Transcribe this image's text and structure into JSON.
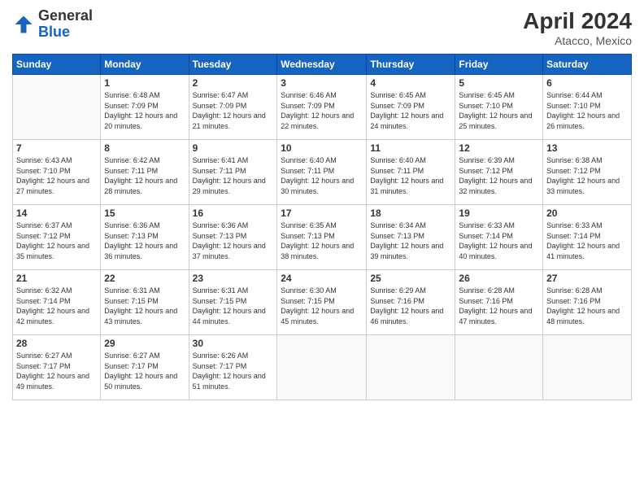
{
  "header": {
    "logo_general": "General",
    "logo_blue": "Blue",
    "month_title": "April 2024",
    "subtitle": "Atacco, Mexico"
  },
  "days_of_week": [
    "Sunday",
    "Monday",
    "Tuesday",
    "Wednesday",
    "Thursday",
    "Friday",
    "Saturday"
  ],
  "weeks": [
    [
      {
        "day": "",
        "sunrise": "",
        "sunset": "",
        "daylight": ""
      },
      {
        "day": "1",
        "sunrise": "Sunrise: 6:48 AM",
        "sunset": "Sunset: 7:09 PM",
        "daylight": "Daylight: 12 hours and 20 minutes."
      },
      {
        "day": "2",
        "sunrise": "Sunrise: 6:47 AM",
        "sunset": "Sunset: 7:09 PM",
        "daylight": "Daylight: 12 hours and 21 minutes."
      },
      {
        "day": "3",
        "sunrise": "Sunrise: 6:46 AM",
        "sunset": "Sunset: 7:09 PM",
        "daylight": "Daylight: 12 hours and 22 minutes."
      },
      {
        "day": "4",
        "sunrise": "Sunrise: 6:45 AM",
        "sunset": "Sunset: 7:09 PM",
        "daylight": "Daylight: 12 hours and 24 minutes."
      },
      {
        "day": "5",
        "sunrise": "Sunrise: 6:45 AM",
        "sunset": "Sunset: 7:10 PM",
        "daylight": "Daylight: 12 hours and 25 minutes."
      },
      {
        "day": "6",
        "sunrise": "Sunrise: 6:44 AM",
        "sunset": "Sunset: 7:10 PM",
        "daylight": "Daylight: 12 hours and 26 minutes."
      }
    ],
    [
      {
        "day": "7",
        "sunrise": "Sunrise: 6:43 AM",
        "sunset": "Sunset: 7:10 PM",
        "daylight": "Daylight: 12 hours and 27 minutes."
      },
      {
        "day": "8",
        "sunrise": "Sunrise: 6:42 AM",
        "sunset": "Sunset: 7:11 PM",
        "daylight": "Daylight: 12 hours and 28 minutes."
      },
      {
        "day": "9",
        "sunrise": "Sunrise: 6:41 AM",
        "sunset": "Sunset: 7:11 PM",
        "daylight": "Daylight: 12 hours and 29 minutes."
      },
      {
        "day": "10",
        "sunrise": "Sunrise: 6:40 AM",
        "sunset": "Sunset: 7:11 PM",
        "daylight": "Daylight: 12 hours and 30 minutes."
      },
      {
        "day": "11",
        "sunrise": "Sunrise: 6:40 AM",
        "sunset": "Sunset: 7:11 PM",
        "daylight": "Daylight: 12 hours and 31 minutes."
      },
      {
        "day": "12",
        "sunrise": "Sunrise: 6:39 AM",
        "sunset": "Sunset: 7:12 PM",
        "daylight": "Daylight: 12 hours and 32 minutes."
      },
      {
        "day": "13",
        "sunrise": "Sunrise: 6:38 AM",
        "sunset": "Sunset: 7:12 PM",
        "daylight": "Daylight: 12 hours and 33 minutes."
      }
    ],
    [
      {
        "day": "14",
        "sunrise": "Sunrise: 6:37 AM",
        "sunset": "Sunset: 7:12 PM",
        "daylight": "Daylight: 12 hours and 35 minutes."
      },
      {
        "day": "15",
        "sunrise": "Sunrise: 6:36 AM",
        "sunset": "Sunset: 7:13 PM",
        "daylight": "Daylight: 12 hours and 36 minutes."
      },
      {
        "day": "16",
        "sunrise": "Sunrise: 6:36 AM",
        "sunset": "Sunset: 7:13 PM",
        "daylight": "Daylight: 12 hours and 37 minutes."
      },
      {
        "day": "17",
        "sunrise": "Sunrise: 6:35 AM",
        "sunset": "Sunset: 7:13 PM",
        "daylight": "Daylight: 12 hours and 38 minutes."
      },
      {
        "day": "18",
        "sunrise": "Sunrise: 6:34 AM",
        "sunset": "Sunset: 7:13 PM",
        "daylight": "Daylight: 12 hours and 39 minutes."
      },
      {
        "day": "19",
        "sunrise": "Sunrise: 6:33 AM",
        "sunset": "Sunset: 7:14 PM",
        "daylight": "Daylight: 12 hours and 40 minutes."
      },
      {
        "day": "20",
        "sunrise": "Sunrise: 6:33 AM",
        "sunset": "Sunset: 7:14 PM",
        "daylight": "Daylight: 12 hours and 41 minutes."
      }
    ],
    [
      {
        "day": "21",
        "sunrise": "Sunrise: 6:32 AM",
        "sunset": "Sunset: 7:14 PM",
        "daylight": "Daylight: 12 hours and 42 minutes."
      },
      {
        "day": "22",
        "sunrise": "Sunrise: 6:31 AM",
        "sunset": "Sunset: 7:15 PM",
        "daylight": "Daylight: 12 hours and 43 minutes."
      },
      {
        "day": "23",
        "sunrise": "Sunrise: 6:31 AM",
        "sunset": "Sunset: 7:15 PM",
        "daylight": "Daylight: 12 hours and 44 minutes."
      },
      {
        "day": "24",
        "sunrise": "Sunrise: 6:30 AM",
        "sunset": "Sunset: 7:15 PM",
        "daylight": "Daylight: 12 hours and 45 minutes."
      },
      {
        "day": "25",
        "sunrise": "Sunrise: 6:29 AM",
        "sunset": "Sunset: 7:16 PM",
        "daylight": "Daylight: 12 hours and 46 minutes."
      },
      {
        "day": "26",
        "sunrise": "Sunrise: 6:28 AM",
        "sunset": "Sunset: 7:16 PM",
        "daylight": "Daylight: 12 hours and 47 minutes."
      },
      {
        "day": "27",
        "sunrise": "Sunrise: 6:28 AM",
        "sunset": "Sunset: 7:16 PM",
        "daylight": "Daylight: 12 hours and 48 minutes."
      }
    ],
    [
      {
        "day": "28",
        "sunrise": "Sunrise: 6:27 AM",
        "sunset": "Sunset: 7:17 PM",
        "daylight": "Daylight: 12 hours and 49 minutes."
      },
      {
        "day": "29",
        "sunrise": "Sunrise: 6:27 AM",
        "sunset": "Sunset: 7:17 PM",
        "daylight": "Daylight: 12 hours and 50 minutes."
      },
      {
        "day": "30",
        "sunrise": "Sunrise: 6:26 AM",
        "sunset": "Sunset: 7:17 PM",
        "daylight": "Daylight: 12 hours and 51 minutes."
      },
      {
        "day": "",
        "sunrise": "",
        "sunset": "",
        "daylight": ""
      },
      {
        "day": "",
        "sunrise": "",
        "sunset": "",
        "daylight": ""
      },
      {
        "day": "",
        "sunrise": "",
        "sunset": "",
        "daylight": ""
      },
      {
        "day": "",
        "sunrise": "",
        "sunset": "",
        "daylight": ""
      }
    ]
  ]
}
